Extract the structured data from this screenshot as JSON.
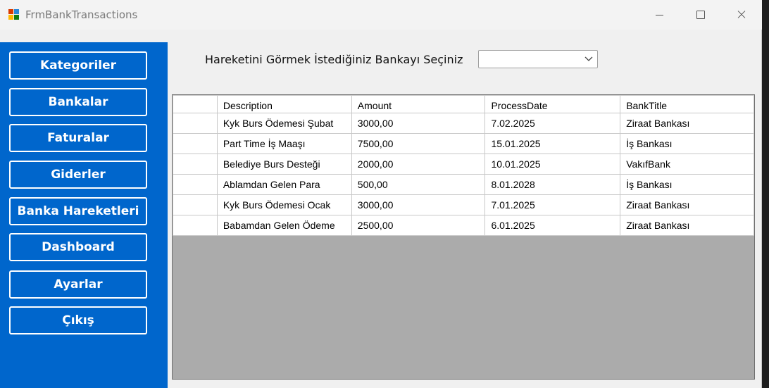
{
  "window": {
    "title": "FrmBankTransactions",
    "icon": "winforms-app-icon"
  },
  "sidebar": {
    "buttons": [
      "Kategoriler",
      "Bankalar",
      "Faturalar",
      "Giderler",
      "Banka Hareketleri",
      "Dashboard",
      "Ayarlar",
      "Çıkış"
    ],
    "color": "#0066cc"
  },
  "filter": {
    "label": "Hareketini Görmek İstediğiniz Bankayı Seçiniz",
    "selected": ""
  },
  "grid": {
    "columns": [
      "Description",
      "Amount",
      "ProcessDate",
      "BankTitle"
    ],
    "rows": [
      [
        "Kyk Burs Ödemesi Şubat",
        "3000,00",
        "7.02.2025",
        "Ziraat Bankası"
      ],
      [
        "Part Time İş Maaşı",
        "7500,00",
        "15.01.2025",
        "İş Bankası"
      ],
      [
        "Belediye Burs Desteği",
        "2000,00",
        "10.01.2025",
        "VakıfBank"
      ],
      [
        "Ablamdan Gelen Para",
        "500,00",
        "8.01.2028",
        "İş Bankası"
      ],
      [
        "Kyk Burs Ödemesi Ocak",
        "3000,00",
        "7.01.2025",
        "Ziraat Bankası"
      ],
      [
        "Babamdan Gelen Ödeme",
        "2500,00",
        "6.01.2025",
        "Ziraat Bankası"
      ]
    ]
  }
}
